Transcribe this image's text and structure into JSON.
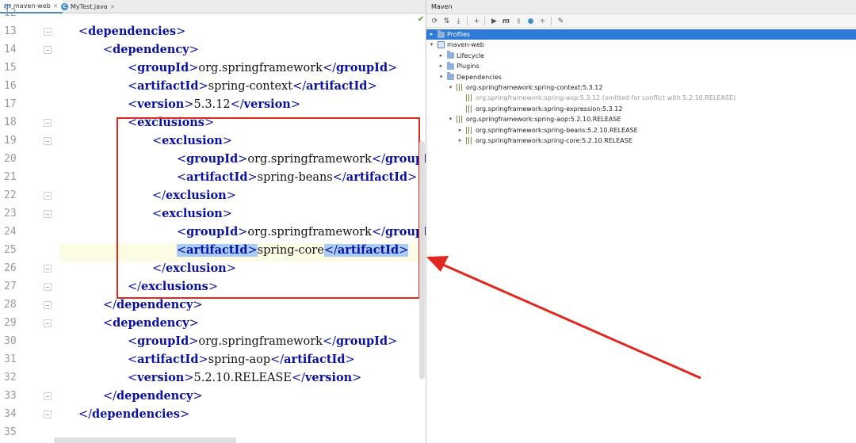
{
  "tabs": [
    {
      "label": "maven-web",
      "icon": "maven-icon"
    },
    {
      "label": "MyTest.java",
      "icon": "java-class-icon"
    }
  ],
  "editor": {
    "lines": [
      {
        "num": "12",
        "text": ""
      },
      {
        "num": "13",
        "indent": 1,
        "parts": [
          {
            "t": "tag",
            "v": "dependencies"
          }
        ]
      },
      {
        "num": "14",
        "indent": 2,
        "parts": [
          {
            "t": "tag",
            "v": "dependency"
          }
        ]
      },
      {
        "num": "15",
        "indent": 3,
        "parts": [
          {
            "t": "tag",
            "v": "groupId"
          },
          {
            "t": "txt",
            "v": "org.springframework"
          },
          {
            "t": "ctag",
            "v": "groupId"
          }
        ]
      },
      {
        "num": "16",
        "indent": 3,
        "parts": [
          {
            "t": "tag",
            "v": "artifactId"
          },
          {
            "t": "txt",
            "v": "spring-context"
          },
          {
            "t": "ctag",
            "v": "artifactId"
          }
        ]
      },
      {
        "num": "17",
        "indent": 3,
        "parts": [
          {
            "t": "tag",
            "v": "version"
          },
          {
            "t": "txt",
            "v": "5.3.12"
          },
          {
            "t": "ctag",
            "v": "version"
          }
        ]
      },
      {
        "num": "18",
        "indent": 3,
        "parts": [
          {
            "t": "tag",
            "v": "exclusions"
          }
        ]
      },
      {
        "num": "19",
        "indent": 4,
        "parts": [
          {
            "t": "tag",
            "v": "exclusion"
          }
        ]
      },
      {
        "num": "20",
        "indent": 5,
        "parts": [
          {
            "t": "tag",
            "v": "groupId"
          },
          {
            "t": "txt",
            "v": "org.springframework"
          },
          {
            "t": "ctag",
            "v": "groupId"
          }
        ]
      },
      {
        "num": "21",
        "indent": 5,
        "parts": [
          {
            "t": "tag",
            "v": "artifactId"
          },
          {
            "t": "txt",
            "v": "spring-beans"
          },
          {
            "t": "ctag",
            "v": "artifactId"
          }
        ]
      },
      {
        "num": "22",
        "indent": 4,
        "parts": [
          {
            "t": "ctag",
            "v": "exclusion"
          }
        ]
      },
      {
        "num": "23",
        "indent": 4,
        "parts": [
          {
            "t": "tag",
            "v": "exclusion"
          }
        ]
      },
      {
        "num": "24",
        "indent": 5,
        "parts": [
          {
            "t": "tag",
            "v": "groupId"
          },
          {
            "t": "txt",
            "v": "org.springframework"
          },
          {
            "t": "ctag",
            "v": "groupId"
          }
        ]
      },
      {
        "num": "25",
        "indent": 5,
        "parts": [
          {
            "t": "tag",
            "v": "artifactId",
            "hl": true
          },
          {
            "t": "txt",
            "v": "spring-core"
          },
          {
            "t": "ctag",
            "v": "artifactId",
            "hl": true
          }
        ]
      },
      {
        "num": "26",
        "indent": 4,
        "parts": [
          {
            "t": "ctag",
            "v": "exclusion"
          }
        ]
      },
      {
        "num": "27",
        "indent": 3,
        "parts": [
          {
            "t": "ctag",
            "v": "exclusions"
          }
        ]
      },
      {
        "num": "28",
        "indent": 2,
        "parts": [
          {
            "t": "ctag",
            "v": "dependency"
          }
        ]
      },
      {
        "num": "29",
        "indent": 2,
        "parts": [
          {
            "t": "tag",
            "v": "dependency"
          }
        ]
      },
      {
        "num": "30",
        "indent": 3,
        "parts": [
          {
            "t": "tag",
            "v": "groupId"
          },
          {
            "t": "txt",
            "v": "org.springframework"
          },
          {
            "t": "ctag",
            "v": "groupId"
          }
        ]
      },
      {
        "num": "31",
        "indent": 3,
        "parts": [
          {
            "t": "tag",
            "v": "artifactId"
          },
          {
            "t": "txt",
            "v": "spring-aop"
          },
          {
            "t": "ctag",
            "v": "artifactId"
          }
        ]
      },
      {
        "num": "32",
        "indent": 3,
        "parts": [
          {
            "t": "tag",
            "v": "version"
          },
          {
            "t": "txt",
            "v": "5.2.10.RELEASE"
          },
          {
            "t": "ctag",
            "v": "version"
          }
        ]
      },
      {
        "num": "33",
        "indent": 2,
        "parts": [
          {
            "t": "ctag",
            "v": "dependency"
          }
        ]
      },
      {
        "num": "34",
        "indent": 1,
        "parts": [
          {
            "t": "ctag",
            "v": "dependencies"
          }
        ]
      },
      {
        "num": "35",
        "text": ""
      }
    ]
  },
  "maven": {
    "title": "Maven",
    "toolbar": [
      "refresh-icon",
      "reimport-icon",
      "download-icon",
      "add-icon",
      "run-icon",
      "execute-goal-icon",
      "toggle-offline-icon",
      "skip-tests-icon",
      "show-diagram-icon",
      "collapse-all-icon",
      "settings-icon"
    ],
    "tree": [
      {
        "label": "Profiles",
        "level": 0,
        "arrow": "▸",
        "icon": "folder",
        "selected": true
      },
      {
        "label": "maven-web",
        "level": 0,
        "arrow": "▾",
        "icon": "mod"
      },
      {
        "label": "Lifecycle",
        "level": 1,
        "arrow": "▸",
        "icon": "folder"
      },
      {
        "label": "Plugins",
        "level": 1,
        "arrow": "▸",
        "icon": "folder"
      },
      {
        "label": "Dependencies",
        "level": 1,
        "arrow": "▾",
        "icon": "folder"
      },
      {
        "label": "org.springframework:spring-context:5.3.12",
        "level": 2,
        "arrow": "▾",
        "icon": "lib"
      },
      {
        "label": "org.springframework:spring-aop:5.3.12 (omitted for conflict with 5.2.10.RELEASE)",
        "level": 3,
        "arrow": "",
        "icon": "lib",
        "grey": true
      },
      {
        "label": "org.springframework:spring-expression:5.3.12",
        "level": 3,
        "arrow": "",
        "icon": "lib"
      },
      {
        "label": "org.springframework:spring-aop:5.2.10.RELEASE",
        "level": 2,
        "arrow": "▾",
        "icon": "lib"
      },
      {
        "label": "org.springframework:spring-beans:5.2.10.RELEASE",
        "level": 3,
        "arrow": "▸",
        "icon": "lib"
      },
      {
        "label": "org.springframework:spring-core:5.2.10.RELEASE",
        "level": 3,
        "arrow": "▸",
        "icon": "lib"
      }
    ]
  },
  "colors": {
    "annotation_red": "#e0281f",
    "selection_blue": "#2f7ad6",
    "tag_blue": "#0a10a0",
    "match_highlight": "#a9cdf4"
  }
}
